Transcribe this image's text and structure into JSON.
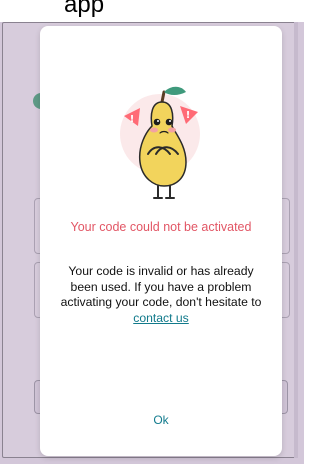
{
  "header": {
    "partial_title": "app"
  },
  "dialog": {
    "title": "Your code could not be activated",
    "message_text": "Your code is invalid or has already been used. If you have a problem activating your code, don't hesitate to",
    "contact_link": "contact us",
    "ok_label": "Ok"
  },
  "colors": {
    "title": "#e25665",
    "link": "#117a8b",
    "overlay": "#d3c7d9",
    "modal": "#ffffff"
  },
  "icons": {
    "illustration": "sad-pear-with-warning-icons"
  }
}
